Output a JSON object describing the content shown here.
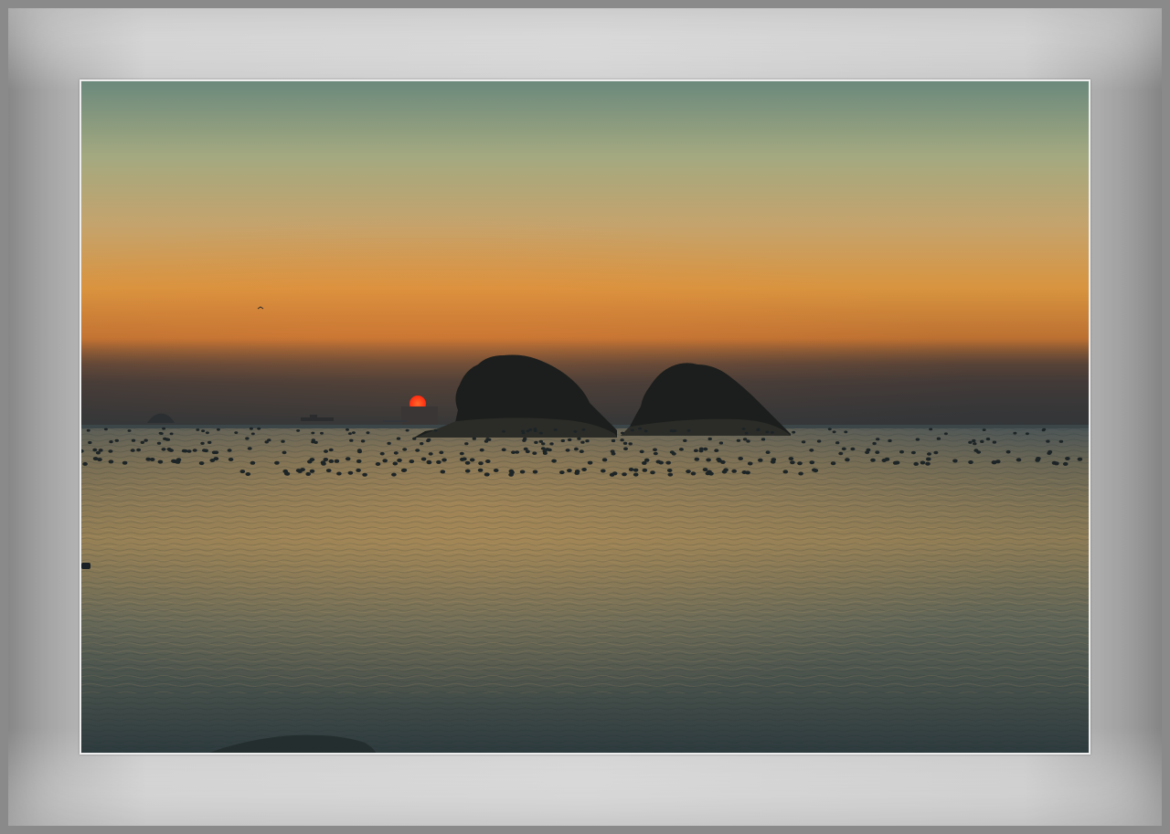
{
  "scene": {
    "subject": "sunset-over-sea-with-two-islands",
    "colors": {
      "sky_top": "#6f8c7f",
      "sky_mid": "#c6a872",
      "sky_glow": "#d98f45",
      "haze": "#3d3a3a",
      "sun": "#ff3b1a",
      "island": "#1c1f1e",
      "sea_near": "#3e4d4e",
      "sea_glow": "#a48456",
      "frame": "#c8c8c8"
    }
  }
}
